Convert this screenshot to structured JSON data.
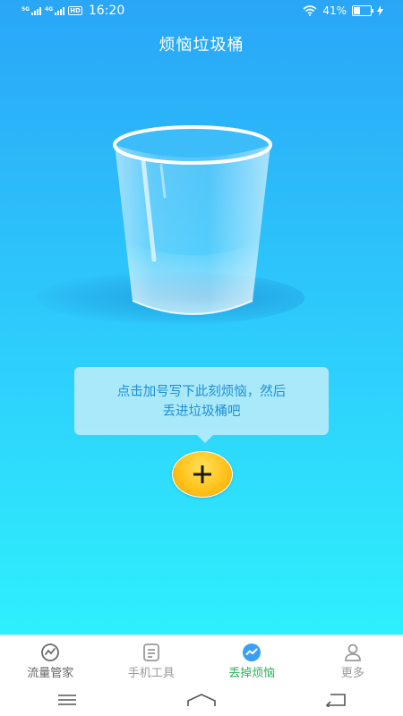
{
  "status_bar": {
    "network1": "5G",
    "network2": "4G",
    "hd": "HD",
    "time": "16:20",
    "battery": "41%",
    "battery_level": 0.41
  },
  "title": "烦恼垃圾桶",
  "tooltip": {
    "line1": "点击加号写下此刻烦恼，然后",
    "line2": "丢进垃圾桶吧"
  },
  "add_button": {
    "icon": "plus-icon"
  },
  "bottom_nav": [
    {
      "label": "流量管家",
      "icon": "traffic-icon",
      "active": false
    },
    {
      "label": "手机工具",
      "icon": "tools-icon",
      "active": false
    },
    {
      "label": "丢掉烦恼",
      "icon": "chart-bubble-icon",
      "active": true
    },
    {
      "label": "更多",
      "icon": "person-icon",
      "active": false
    }
  ],
  "colors": {
    "gradient_top": "#2aa6f7",
    "gradient_bottom": "#2ef0fd",
    "accent_yellow": "#ffc21c",
    "active_nav": "#2bb35a",
    "tooltip_text": "#1c8fd8"
  }
}
